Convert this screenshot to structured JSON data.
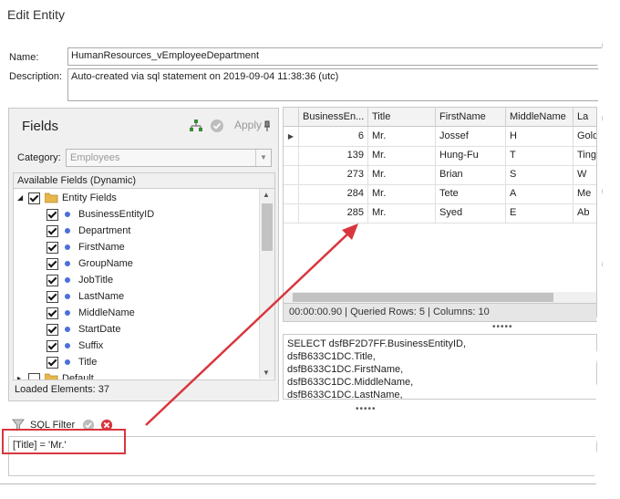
{
  "window": {
    "title": "Edit Entity"
  },
  "form": {
    "name_label": "Name:",
    "name_value": "HumanResources_vEmployeeDepartment",
    "description_label": "Description:",
    "description_value": "Auto-created via sql statement on 2019-09-04 11:38:36 (utc)"
  },
  "fields_panel": {
    "title": "Fields",
    "apply_label": "Apply",
    "category_label": "Category:",
    "category_value": "Employees",
    "available_header": "Available Fields (Dynamic)",
    "group_label": "Entity Fields",
    "items": [
      "BusinessEntityID",
      "Department",
      "FirstName",
      "GroupName",
      "JobTitle",
      "LastName",
      "MiddleName",
      "StartDate",
      "Suffix",
      "Title"
    ],
    "next_group": "Default",
    "loaded_text": "Loaded Elements: 37"
  },
  "grid": {
    "columns": [
      "BusinessEn...",
      "Title",
      "FirstName",
      "MiddleName",
      "La"
    ],
    "rows": [
      [
        "6",
        "Mr.",
        "Jossef",
        "H",
        "Gold"
      ],
      [
        "139",
        "Mr.",
        "Hung-Fu",
        "T",
        "Ting"
      ],
      [
        "273",
        "Mr.",
        "Brian",
        "S",
        "W"
      ],
      [
        "284",
        "Mr.",
        "Tete",
        "A",
        "Me"
      ],
      [
        "285",
        "Mr.",
        "Syed",
        "E",
        "Ab"
      ]
    ]
  },
  "status": {
    "text": "00:00:00.90 | Queried Rows: 5 | Columns: 10"
  },
  "sql": {
    "lines": [
      "SELECT dsfBF2D7FF.BusinessEntityID,",
      "dsfB633C1DC.Title,",
      "dsfB633C1DC.FirstName,",
      "dsfB633C1DC.MiddleName,",
      "dsfB633C1DC.LastName,"
    ]
  },
  "filter": {
    "label": "SQL Filter",
    "value": "[Title] = 'Mr.'"
  },
  "colors": {
    "highlight": "#d9363e",
    "dot": "#4a6fd8",
    "accent_folder": "#e8b64a"
  },
  "icons": [
    "hierarchy-icon",
    "check-circle-icon",
    "pin-icon",
    "folder-icon",
    "filter-icon",
    "clear-icon"
  ]
}
